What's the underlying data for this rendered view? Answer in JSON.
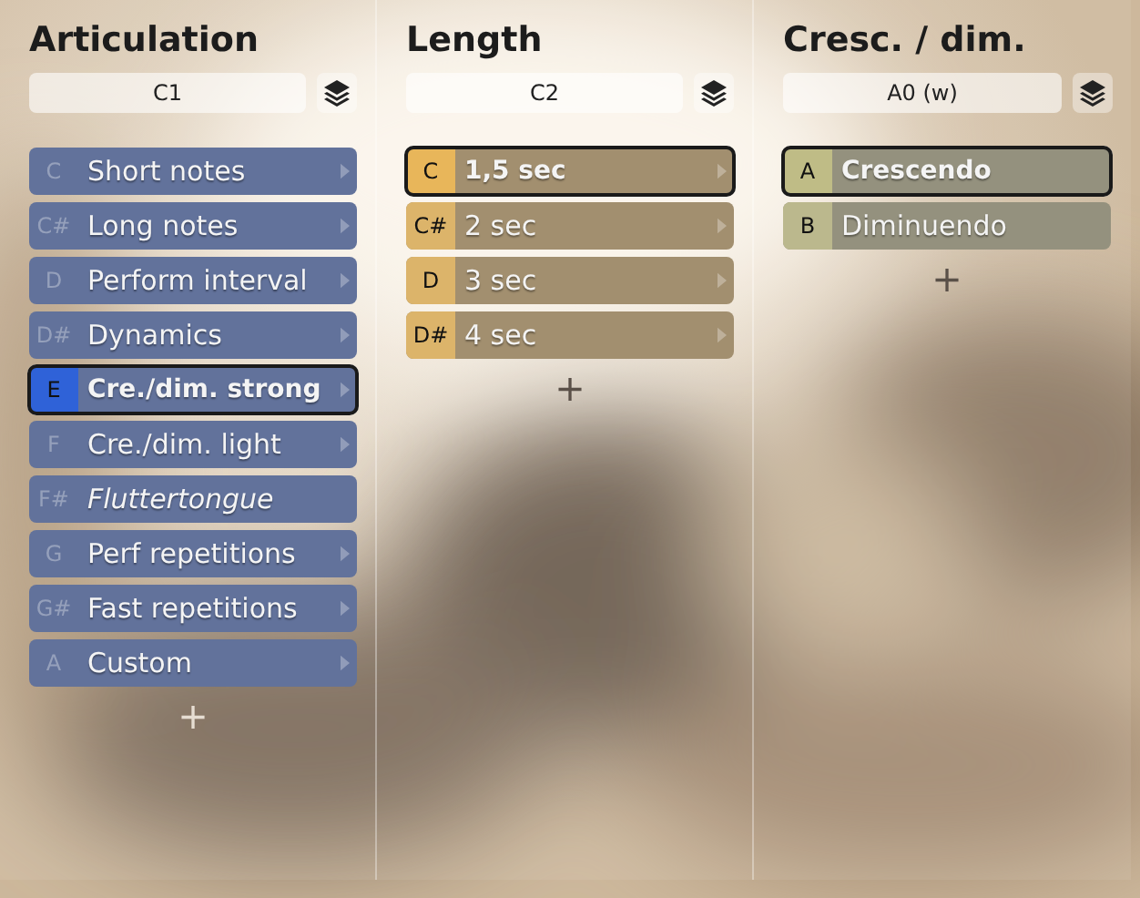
{
  "columns": [
    {
      "title": "Articulation",
      "selector": "C1",
      "color": "#2f62d8",
      "kind": "plain",
      "items": [
        {
          "key": "C",
          "label": "Short notes",
          "kind": "submenu",
          "selected": false
        },
        {
          "key": "C#",
          "label": "Long notes",
          "kind": "submenu",
          "selected": false
        },
        {
          "key": "D",
          "label": "Perform interval",
          "kind": "submenu",
          "selected": false
        },
        {
          "key": "D#",
          "label": "Dynamics",
          "kind": "submenu",
          "selected": false
        },
        {
          "key": "E",
          "label": "Cre./dim. strong",
          "kind": "submenu",
          "selected": true
        },
        {
          "key": "F",
          "label": "Cre./dim. light",
          "kind": "submenu",
          "selected": false
        },
        {
          "key": "F#",
          "label": "Fluttertongue",
          "kind": "leaf",
          "selected": false
        },
        {
          "key": "G",
          "label": "Perf repetitions",
          "kind": "submenu",
          "selected": false
        },
        {
          "key": "G#",
          "label": "Fast repetitions",
          "kind": "submenu",
          "selected": false
        },
        {
          "key": "A",
          "label": "Custom",
          "kind": "submenu",
          "selected": false
        }
      ],
      "add": "+"
    },
    {
      "title": "Length",
      "selector": "C2",
      "color": "#e8b65a",
      "kind": "keyed",
      "items": [
        {
          "key": "C",
          "label": "1,5 sec",
          "kind": "submenu",
          "selected": true
        },
        {
          "key": "C#",
          "label": "2 sec",
          "kind": "submenu",
          "selected": false
        },
        {
          "key": "D",
          "label": "3 sec",
          "kind": "submenu",
          "selected": false
        },
        {
          "key": "D#",
          "label": "4 sec",
          "kind": "submenu",
          "selected": false
        }
      ],
      "add": "+"
    },
    {
      "title": "Cresc. / dim.",
      "selector": "A0 (w)",
      "color": "#bfbc86",
      "kind": "keyed",
      "items": [
        {
          "key": "A",
          "label": "Crescendo",
          "kind": "leaf",
          "selected": true
        },
        {
          "key": "B",
          "label": "Diminuendo",
          "kind": "leaf",
          "selected": false
        }
      ],
      "add": "+"
    }
  ]
}
